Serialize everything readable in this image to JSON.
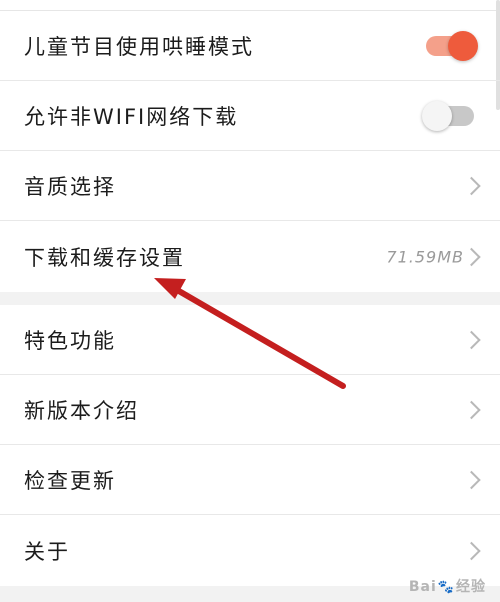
{
  "settings": {
    "kids_sleep_mode_label": "儿童节目使用哄睡模式",
    "kids_sleep_mode_on": true,
    "non_wifi_download_label": "允许非WIFI网络下载",
    "non_wifi_download_on": false,
    "audio_quality_label": "音质选择",
    "download_cache_label": "下载和缓存设置",
    "download_cache_size": "71.59MB",
    "features_label": "特色功能",
    "whats_new_label": "新版本介绍",
    "check_update_label": "检查更新",
    "about_label": "关于"
  },
  "watermark": {
    "text_left": "Bai",
    "text_right": "经验"
  },
  "colors": {
    "toggle_on": "#ee5b3c",
    "annotation_arrow": "#c41f1f"
  },
  "icons": {
    "chevron": "chevron-right-icon"
  }
}
